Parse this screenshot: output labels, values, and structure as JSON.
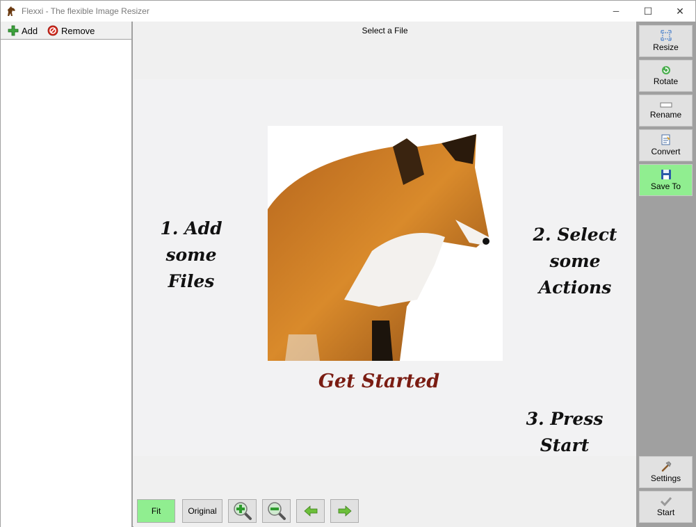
{
  "window": {
    "title": "Flexxi - The flexible Image Resizer",
    "controls": {
      "minimize": "─",
      "maximize": "☐",
      "close": "✕"
    }
  },
  "file_toolbar": {
    "add_label": "Add",
    "remove_label": "Remove"
  },
  "preview": {
    "header": "Select a File",
    "steps": {
      "step1_line1": "1. Add",
      "step1_line2": "some Files",
      "step2_line1": "2. Select",
      "step2_line2": "some Actions",
      "step3": "3. Press Start",
      "get_started": "Get Started"
    },
    "get_started_color": "#7a1c12"
  },
  "view_toolbar": {
    "fit_label": "Fit",
    "original_label": "Original",
    "zoom_in_icon": "zoom-in-icon",
    "zoom_out_icon": "zoom-out-icon",
    "prev_icon": "arrow-left-icon",
    "next_icon": "arrow-right-icon",
    "active_color": "#90ee90"
  },
  "actions": {
    "resize": "Resize",
    "rotate": "Rotate",
    "rename": "Rename",
    "convert": "Convert",
    "save_to": "Save To",
    "settings": "Settings",
    "start": "Start"
  }
}
